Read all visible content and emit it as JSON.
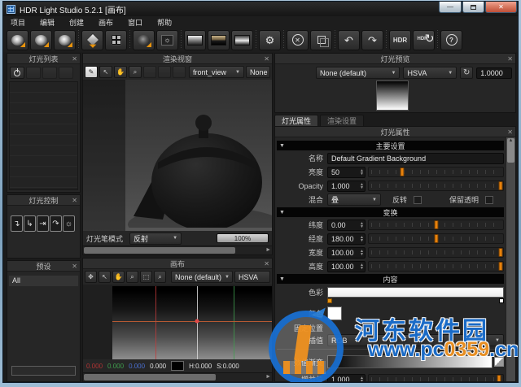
{
  "titlebar": {
    "title": "HDR Light Studio 5.2.1 [画布]"
  },
  "menu": [
    "项目",
    "编辑",
    "创建",
    "画布",
    "窗口",
    "帮助"
  ],
  "toolbar": {
    "hdr": "HDR",
    "hdr2": "HDR",
    "help": "?"
  },
  "icons": {
    "gear": "⚙",
    "delete": "✕",
    "undo": "↶",
    "redo": "↷",
    "cycle": "↻",
    "sun": "☼",
    "close": "✕",
    "arrow": "◢",
    "cursor": "↖",
    "hand": "✋",
    "zoom": "🔍",
    "brush": "✎",
    "move": "✥",
    "marquee": "⬚",
    "zoomsel": "⌕",
    "refresh": "↻",
    "dd_arrow": "▼",
    "spin_up": "▲",
    "spin_down": "▼",
    "ctl1": "↴",
    "ctl2": "↳",
    "ctl3": "⇥",
    "ctl4": "↷",
    "ctl5": "☼",
    "hscroll_arrow": "►",
    "vscroll_arrow": "▲"
  },
  "left": {
    "light_list_title": "灯光列表",
    "light_control_title": "灯光控制",
    "presets_title": "预设",
    "preset_all": "All"
  },
  "render": {
    "title": "渲染视窗",
    "camera": "front_view",
    "light": "None (default",
    "pen_mode_label": "灯光笔模式",
    "pen_mode": "反射",
    "progress": "100%"
  },
  "canvas": {
    "title": "画布",
    "preset": "None (default)",
    "colorspace": "HSVA",
    "r": "0.000",
    "g": "0.000",
    "b": "0.000",
    "a": "0.000",
    "h": "H:0.000",
    "s": "S:0.000"
  },
  "preview": {
    "title": "灯光预览",
    "preset": "None (default)",
    "colorspace": "HSVA",
    "exposure": "1.0000"
  },
  "props": {
    "tab_light": "灯光属性",
    "tab_render": "渲染设置",
    "header": "灯光属性",
    "section_main": "主要设置",
    "name_label": "名称",
    "name_value": "Default Gradient Background",
    "brightness_label": "亮度",
    "brightness_value": "50",
    "opacity_label": "Opacity",
    "opacity_value": "1.000",
    "blend_label": "混合",
    "blend_value": "叠",
    "invert_label": "反转",
    "preserve_label": "保留透明",
    "section_transform": "变换",
    "latitude_label": "纬度",
    "latitude_value": "0.00",
    "longitude_label": "经度",
    "longitude_value": "180.00",
    "width_label": "宽度",
    "width_value": "100.00",
    "height_label": "高度",
    "height_value": "100.00",
    "section_content": "内容",
    "ramp_label": "色彩",
    "color_label": "颜色",
    "fixed_label": "固定位置",
    "interp_label": "插值",
    "interp_value": "RGB",
    "vramp_label": "数值渐变",
    "gain_label": "增益值",
    "gain_value": "1.000"
  },
  "watermark": {
    "site": "河东软件园",
    "url_pre": "www.pc",
    "url_mid": "0359",
    "url_suf": ".cn"
  },
  "colors": {
    "accent": "#e8820c",
    "line_red": "#c23a3a",
    "line_green": "#3f9e4d",
    "line_center": "#d8d8d8",
    "line_h": "#b65a33"
  }
}
